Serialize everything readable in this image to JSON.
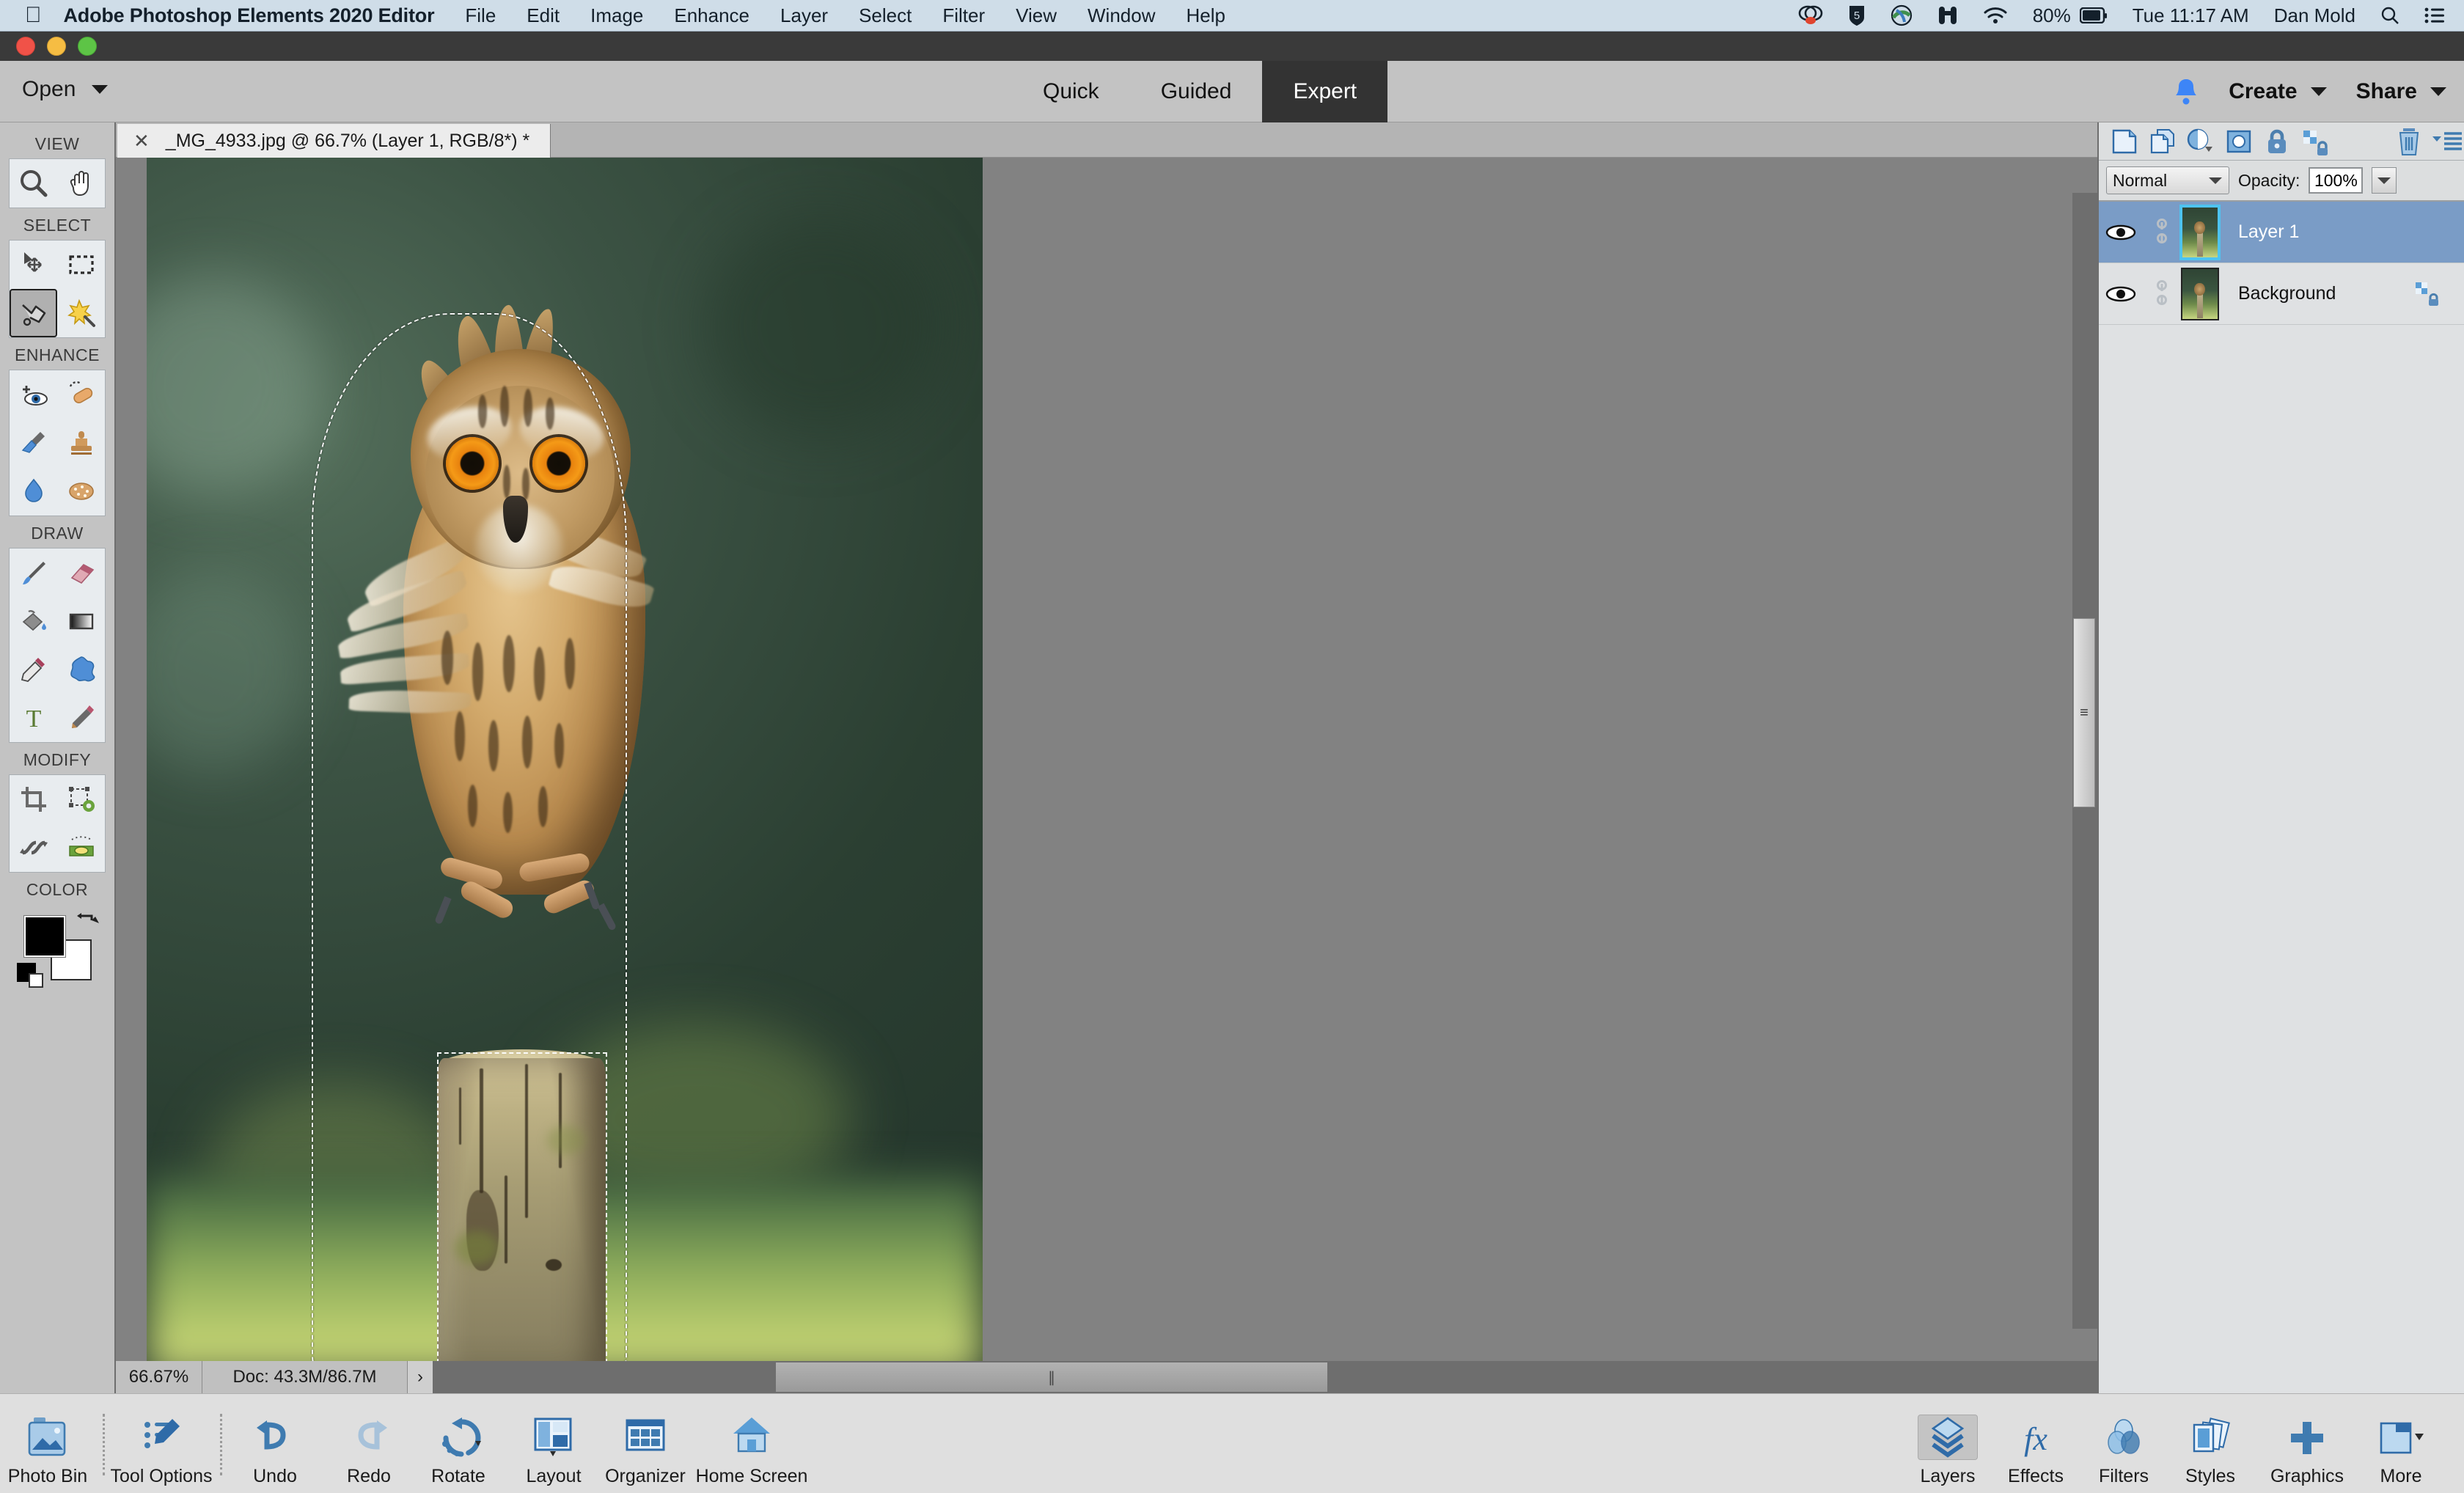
{
  "mac_menubar": {
    "apple_icon": "apple-logo-icon",
    "app_name": "Adobe Photoshop Elements 2020 Editor",
    "menus": [
      "File",
      "Edit",
      "Image",
      "Enhance",
      "Layer",
      "Select",
      "Filter",
      "View",
      "Window",
      "Help"
    ],
    "status_icons": [
      "dropbox-icon",
      "shield-icon",
      "globe-icon",
      "binoculars-icon",
      "wifi-icon"
    ],
    "battery_percent": "80%",
    "clock": "Tue 11:17 AM",
    "user_name": "Dan Mold",
    "search_icon": "search-icon",
    "control_center_icon": "control-center-icon"
  },
  "app_toolbar": {
    "open_label": "Open",
    "open_caret_icon": "chevron-down-icon",
    "mode_tabs": [
      {
        "label": "Quick",
        "active": false
      },
      {
        "label": "Guided",
        "active": false
      },
      {
        "label": "Expert",
        "active": true
      }
    ],
    "bell_icon": "bell-icon",
    "create_label": "Create",
    "share_label": "Share"
  },
  "toolbox": {
    "sections": [
      {
        "label": "VIEW",
        "tools": [
          {
            "name": "zoom-tool",
            "icon": "magnifier-icon",
            "selected": false
          },
          {
            "name": "hand-tool",
            "icon": "hand-icon",
            "selected": false
          }
        ]
      },
      {
        "label": "SELECT",
        "tools": [
          {
            "name": "move-tool",
            "icon": "move-arrows-icon",
            "selected": false
          },
          {
            "name": "rectangular-marquee-tool",
            "icon": "dashed-rectangle-icon",
            "selected": false
          },
          {
            "name": "lasso-tool",
            "icon": "polygonal-lasso-icon",
            "selected": true
          },
          {
            "name": "quick-selection-tool",
            "icon": "magic-wand-icon",
            "selected": false
          }
        ]
      },
      {
        "label": "ENHANCE",
        "tools": [
          {
            "name": "red-eye-removal-tool",
            "icon": "eye-plus-icon",
            "selected": false
          },
          {
            "name": "spot-healing-brush-tool",
            "icon": "bandage-icon",
            "selected": false
          },
          {
            "name": "smart-brush-tool",
            "icon": "paint-brush-icon",
            "selected": false
          },
          {
            "name": "clone-stamp-tool",
            "icon": "stamp-icon",
            "selected": false
          },
          {
            "name": "blur-tool",
            "icon": "water-drop-icon",
            "selected": false
          },
          {
            "name": "sponge-tool",
            "icon": "sponge-icon",
            "selected": false
          }
        ]
      },
      {
        "label": "DRAW",
        "tools": [
          {
            "name": "brush-tool",
            "icon": "brush-icon",
            "selected": false
          },
          {
            "name": "eraser-tool",
            "icon": "eraser-icon",
            "selected": false
          },
          {
            "name": "paint-bucket-tool",
            "icon": "paint-bucket-icon",
            "selected": false
          },
          {
            "name": "gradient-tool",
            "icon": "gradient-icon",
            "selected": false
          },
          {
            "name": "color-picker-tool",
            "icon": "eyedropper-icon",
            "selected": false
          },
          {
            "name": "custom-shape-tool",
            "icon": "blob-shape-icon",
            "selected": false
          },
          {
            "name": "type-tool",
            "icon": "letter-t-icon",
            "selected": false
          },
          {
            "name": "pencil-tool",
            "icon": "pencil-icon",
            "selected": false
          }
        ]
      },
      {
        "label": "MODIFY",
        "tools": [
          {
            "name": "crop-tool",
            "icon": "crop-icon",
            "selected": false
          },
          {
            "name": "recompose-tool",
            "icon": "transform-gear-icon",
            "selected": false
          },
          {
            "name": "content-aware-move-tool",
            "icon": "swap-arrows-icon",
            "selected": false
          },
          {
            "name": "straighten-tool",
            "icon": "level-icon",
            "selected": false
          }
        ]
      },
      {
        "label": "COLOR",
        "foreground_color": "#000000",
        "background_color": "#ffffff",
        "swap_icon": "swap-colors-icon",
        "default_icon": "default-colors-icon"
      }
    ]
  },
  "document": {
    "tab_close_icon": "close-icon",
    "tab_title": "_MG_4933.jpg @ 66.7% (Layer 1, RGB/8*) *",
    "status_zoom": "66.67%",
    "status_doc": "Doc: 43.3M/86.7M",
    "status_expand_icon": "chevron-right-icon",
    "scroll_grip_icon": "grip-icon",
    "image_subject": "long-eared owl perched on a wooden post with blurred green background",
    "selection_active": true
  },
  "layers_panel": {
    "toolbar_icons": [
      "new-layer-icon",
      "duplicate-layer-icon",
      "adjustment-layer-icon",
      "layer-mask-icon",
      "lock-all-icon",
      "lock-transparency-icon",
      "delete-layer-icon",
      "panel-menu-icon"
    ],
    "blend_mode": "Normal",
    "blend_caret_icon": "chevron-down-icon",
    "opacity_label": "Opacity:",
    "opacity_value": "100%",
    "opacity_caret_icon": "chevron-down-icon",
    "accent_selected": "#7a9cc6",
    "thumb_outline_selected": "#4ec3f0",
    "layers": [
      {
        "name": "Layer 1",
        "visible": true,
        "visibility_icon": "eye-icon",
        "link_icon": "link-icon",
        "selected": true,
        "locked": false
      },
      {
        "name": "Background",
        "visible": true,
        "visibility_icon": "eye-icon",
        "link_icon": "link-icon",
        "selected": false,
        "locked": true,
        "lock_icon": "transparency-lock-icon"
      }
    ]
  },
  "taskbar": {
    "left_items": [
      {
        "label": "Photo Bin",
        "icon": "photo-bin-icon"
      },
      {
        "label": "Tool Options",
        "icon": "tool-options-icon"
      },
      {
        "label": "Undo",
        "icon": "undo-arrow-icon"
      },
      {
        "label": "Redo",
        "icon": "redo-arrow-icon"
      },
      {
        "label": "Rotate",
        "icon": "rotate-icon"
      },
      {
        "label": "Layout",
        "icon": "layout-icon"
      },
      {
        "label": "Organizer",
        "icon": "organizer-grid-icon"
      },
      {
        "label": "Home Screen",
        "icon": "home-icon"
      }
    ],
    "right_items": [
      {
        "label": "Layers",
        "icon": "layers-stack-icon",
        "selected": true
      },
      {
        "label": "Effects",
        "icon": "fx-icon",
        "selected": false
      },
      {
        "label": "Filters",
        "icon": "filters-circles-icon",
        "selected": false
      },
      {
        "label": "Styles",
        "icon": "styles-cards-icon",
        "selected": false
      },
      {
        "label": "Graphics",
        "icon": "plus-icon",
        "selected": false
      },
      {
        "label": "More",
        "icon": "more-panel-icon",
        "selected": false
      }
    ]
  }
}
